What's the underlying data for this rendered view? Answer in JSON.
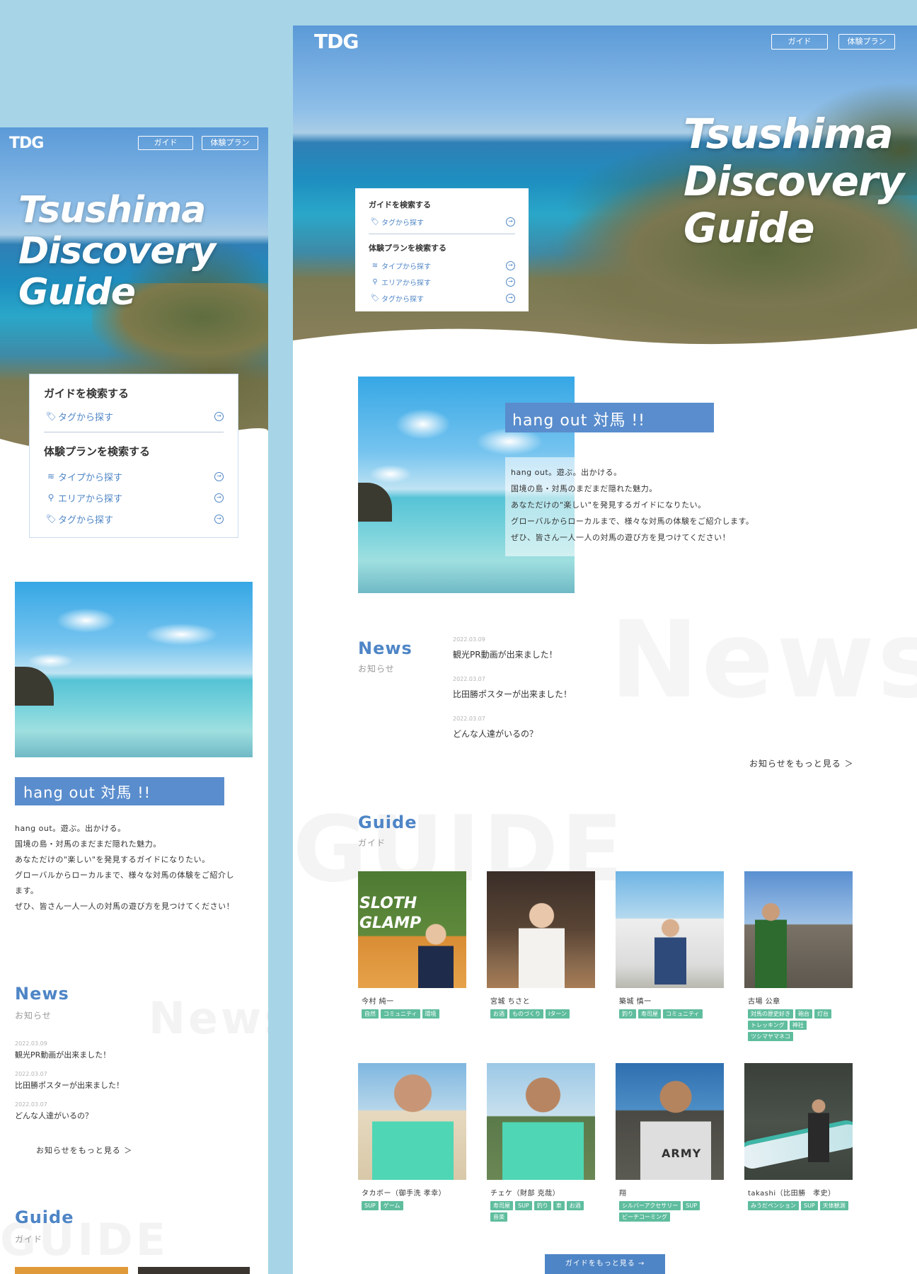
{
  "brand": {
    "logo": "TDG",
    "accent": "#4e85c6",
    "tag_color": "#5fbd9e"
  },
  "nav": {
    "guide": "ガイド",
    "plan": "体験プラン"
  },
  "hero": {
    "title_lines": [
      "Tsushima",
      "Discovery",
      "Guide"
    ]
  },
  "search": {
    "guide_heading": "ガイドを検索する",
    "guide_items": [
      {
        "label": "タグから探す",
        "icon": "tag-icon"
      }
    ],
    "plan_heading": "体験プランを検索する",
    "plan_items": [
      {
        "label": "タイプから探す",
        "icon": "type-icon"
      },
      {
        "label": "エリアから探す",
        "icon": "pin-icon"
      },
      {
        "label": "タグから探す",
        "icon": "tag-icon"
      }
    ]
  },
  "intro": {
    "heading": "hang out 対馬 !!",
    "lines": [
      "hang out。遊ぶ。出かける。",
      "国境の島・対馬のまだまだ隠れた魅力。",
      "あなただけの\"楽しい\"を発見するガイドになりたい。",
      "グローバルからローカルまで、様々な対馬の体験をご紹介します。",
      "ぜひ、皆さん一人一人の対馬の遊び方を見つけてください！"
    ],
    "mobile_lines": [
      "hang out。遊ぶ。出かける。",
      "国境の島・対馬のまだまだ隠れた魅力。",
      "あなただけの\"楽しい\"を発見するガイドになりたい。",
      "グローバルからローカルまで、様々な対馬の体験をご紹介し",
      "ます。",
      "ぜひ、皆さん一人一人の対馬の遊び方を見つけてください！"
    ]
  },
  "news": {
    "title": "News",
    "subtitle": "お知らせ",
    "watermark": "News",
    "items": [
      {
        "date": "2022.03.09",
        "title": "観光PR動画が出来ました！"
      },
      {
        "date": "2022.03.07",
        "title": "比田勝ポスターが出来ました！"
      },
      {
        "date": "2022.03.07",
        "title": "どんな人達がいるの？"
      }
    ],
    "more": "お知らせをもっと見る ＞"
  },
  "guide": {
    "title": "Guide",
    "subtitle": "ガイド",
    "watermark": "GUIDE",
    "more": "ガイドをもっと見る →",
    "people": [
      {
        "name": "今村 純一",
        "tags": [
          "自然",
          "コミュニティ",
          "環境"
        ],
        "photo_text": "SLOTH GLAMP"
      },
      {
        "name": "宮城 ちさと",
        "tags": [
          "お酒",
          "ものづくり",
          "Iターン"
        ]
      },
      {
        "name": "築城 慎一",
        "tags": [
          "釣り",
          "寿司屋",
          "コミュニティ"
        ]
      },
      {
        "name": "古場 公章",
        "tags": [
          "対馬の歴史好き",
          "砲台",
          "灯台",
          "トレッキング",
          "神社",
          "ツシマヤマネコ"
        ]
      },
      {
        "name": "タカボー（御手洗 孝幸）",
        "tags": [
          "SUP",
          "ゲーム"
        ]
      },
      {
        "name": "チェケ（財部 克哉）",
        "tags": [
          "寿司屋",
          "SUP",
          "釣り",
          "車",
          "お酒",
          "音楽"
        ]
      },
      {
        "name": "翔",
        "tags": [
          "シルバーアクセサリー",
          "SUP",
          "ビーチコーミング"
        ],
        "photo_text": "ARMY"
      },
      {
        "name": "takashi（比田勝　孝史）",
        "tags": [
          "みうだペンション",
          "SUP",
          "天体観測"
        ]
      }
    ]
  }
}
